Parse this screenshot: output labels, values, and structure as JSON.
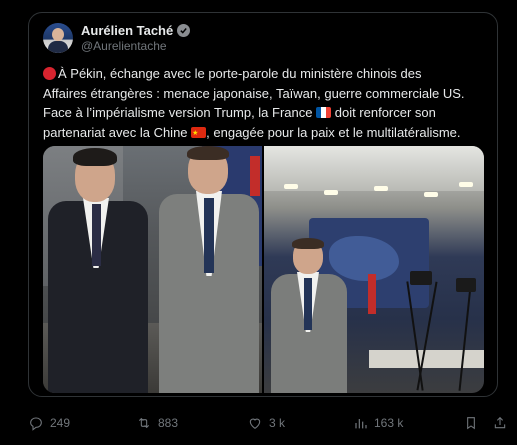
{
  "author": {
    "display_name": "Aurélien Taché",
    "handle": "@Aurelientache",
    "verified_icon": "verified-badge-icon"
  },
  "tweet": {
    "line1": "À Pékin, échange avec le porte-parole du ministère chinois des",
    "line2": "Affaires étrangères : menace japonaise, Taïwan, guerre commerciale US.",
    "line3_a": "Face à l’impérialisme version Trump, la France",
    "line3_b": "doit renforcer son",
    "line4_a": "partenariat avec la Chine",
    "line4_b": ", engagée pour la paix et le multilatéralisme.",
    "icons": [
      "red-circle-icon",
      "flag-france-icon",
      "flag-china-icon"
    ]
  },
  "media": {
    "count": 2
  },
  "actions": {
    "replies": "249",
    "reposts": "883",
    "likes": "3 k",
    "views": "163 k"
  },
  "colors": {
    "background": "#000000",
    "text": "#e7e9ea",
    "muted": "#71767b",
    "border": "#2f3336"
  }
}
